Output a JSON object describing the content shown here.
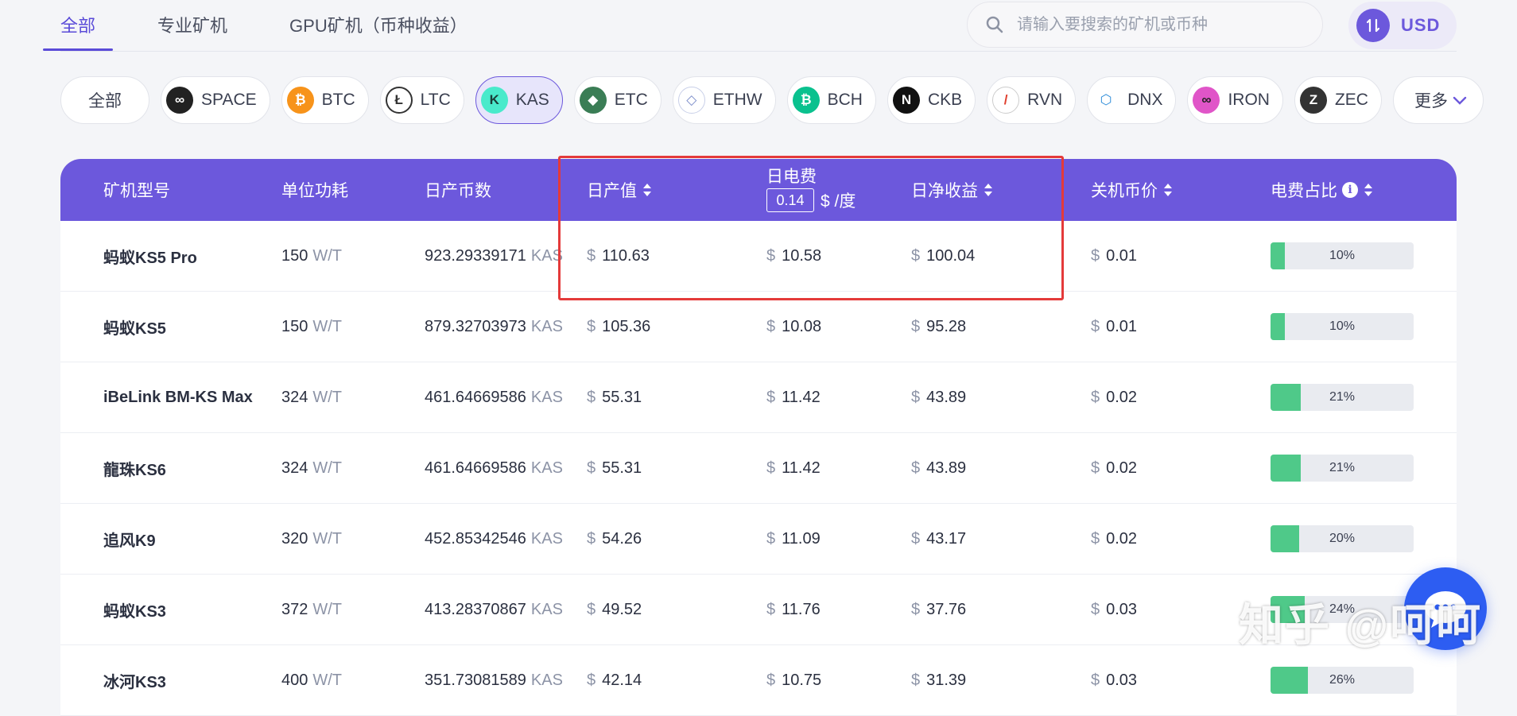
{
  "tabs": [
    {
      "label": "全部",
      "active": true
    },
    {
      "label": "专业矿机",
      "active": false
    },
    {
      "label": "GPU矿机（币种收益）",
      "active": false
    }
  ],
  "search": {
    "placeholder": "请输入要搜索的矿机或币种",
    "icon": "search-icon"
  },
  "currency": {
    "label": "USD",
    "icon": "swap-icon",
    "color": "#6c58dc"
  },
  "coins": [
    {
      "label": "全部"
    },
    {
      "label": "SPACE",
      "color": "#222222",
      "glyph": "∞"
    },
    {
      "label": "BTC",
      "color": "#f7931a",
      "glyph": "₿"
    },
    {
      "label": "LTC",
      "color": "#ffffff",
      "glyph": "Ł"
    },
    {
      "label": "KAS",
      "color": "#49eacb",
      "glyph": "K",
      "active": true
    },
    {
      "label": "ETC",
      "color": "#3a7d55",
      "glyph": "◆"
    },
    {
      "label": "ETHW",
      "color": "#ffffff",
      "glyph": "◇"
    },
    {
      "label": "BCH",
      "color": "#0ac18e",
      "glyph": "₿"
    },
    {
      "label": "CKB",
      "color": "#111111",
      "glyph": "N"
    },
    {
      "label": "RVN",
      "color": "#ffffff",
      "glyph": "/"
    },
    {
      "label": "DNX",
      "color": "#ffffff",
      "glyph": "⬡"
    },
    {
      "label": "IRON",
      "color": "#e055c8",
      "glyph": "∞"
    },
    {
      "label": "ZEC",
      "color": "#333333",
      "glyph": "Z"
    }
  ],
  "more_label": "更多",
  "table": {
    "headers": {
      "model": "矿机型号",
      "power": "单位功耗",
      "daily_coins": "日产币数",
      "daily_value": "日产值",
      "daily_elec": "日电费",
      "elec_price": "0.14",
      "elec_unit": "$ /度",
      "daily_profit": "日净收益",
      "shutdown_price": "关机币价",
      "elec_ratio": "电费占比"
    },
    "rows": [
      {
        "model": "蚂蚁KS5 Pro",
        "power": "150",
        "power_unit": "W/T",
        "coins": "923.29339171",
        "coin_unit": "KAS",
        "value": "110.63",
        "elec": "10.58",
        "profit": "100.04",
        "shutdown": "0.01",
        "ratio": 0.1,
        "ratio_label": "10%"
      },
      {
        "model": "蚂蚁KS5",
        "power": "150",
        "power_unit": "W/T",
        "coins": "879.32703973",
        "coin_unit": "KAS",
        "value": "105.36",
        "elec": "10.08",
        "profit": "95.28",
        "shutdown": "0.01",
        "ratio": 0.1,
        "ratio_label": "10%"
      },
      {
        "model": "iBeLink BM-KS Max",
        "power": "324",
        "power_unit": "W/T",
        "coins": "461.64669586",
        "coin_unit": "KAS",
        "value": "55.31",
        "elec": "11.42",
        "profit": "43.89",
        "shutdown": "0.02",
        "ratio": 0.21,
        "ratio_label": "21%"
      },
      {
        "model": "龍珠KS6",
        "power": "324",
        "power_unit": "W/T",
        "coins": "461.64669586",
        "coin_unit": "KAS",
        "value": "55.31",
        "elec": "11.42",
        "profit": "43.89",
        "shutdown": "0.02",
        "ratio": 0.21,
        "ratio_label": "21%"
      },
      {
        "model": "追风K9",
        "power": "320",
        "power_unit": "W/T",
        "coins": "452.85342546",
        "coin_unit": "KAS",
        "value": "54.26",
        "elec": "11.09",
        "profit": "43.17",
        "shutdown": "0.02",
        "ratio": 0.2,
        "ratio_label": "20%"
      },
      {
        "model": "蚂蚁KS3",
        "power": "372",
        "power_unit": "W/T",
        "coins": "413.28370867",
        "coin_unit": "KAS",
        "value": "49.52",
        "elec": "11.76",
        "profit": "37.76",
        "shutdown": "0.03",
        "ratio": 0.24,
        "ratio_label": "24%"
      },
      {
        "model": "冰河KS3",
        "power": "400",
        "power_unit": "W/T",
        "coins": "351.73081589",
        "coin_unit": "KAS",
        "value": "42.14",
        "elec": "10.75",
        "profit": "31.39",
        "shutdown": "0.03",
        "ratio": 0.26,
        "ratio_label": "26%"
      }
    ]
  },
  "chat": {
    "icon": "chat-icon"
  },
  "watermark": "知乎 @呵呵"
}
